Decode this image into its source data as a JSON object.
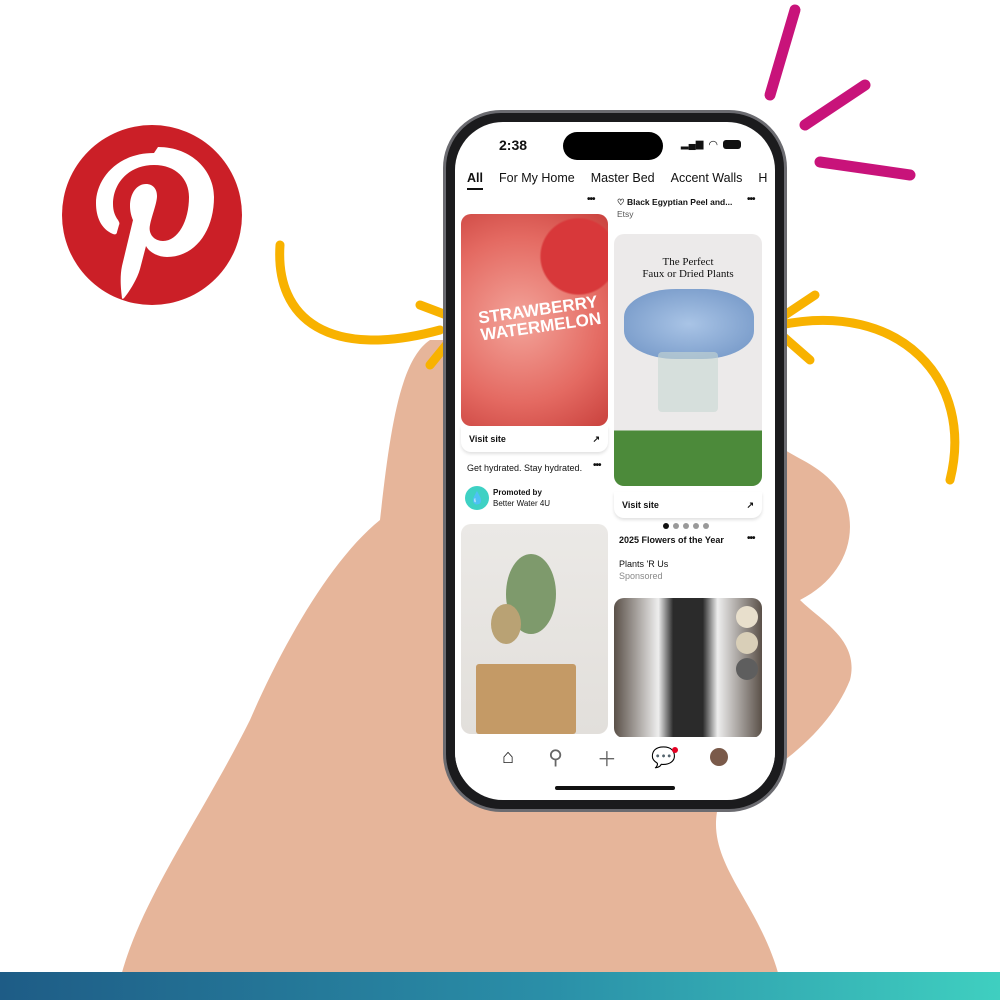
{
  "brand": {
    "logo": "pinterest-logo",
    "color": "#cb1f27"
  },
  "status_bar": {
    "time": "2:38"
  },
  "tabs": [
    {
      "label": "All",
      "active": true
    },
    {
      "label": "For My Home"
    },
    {
      "label": "Master Bed"
    },
    {
      "label": "Accent Walls"
    },
    {
      "label": "H"
    }
  ],
  "feed": {
    "top_right": {
      "title": "♡ Black Egyptian Peel and...",
      "source": "Etsy"
    },
    "pin1": {
      "image_text": "STRAWBERRY WATERMELON",
      "visit": "Visit site",
      "description": "Get hydrated. Stay hydrated.",
      "promoted_by": "Promoted by",
      "advertiser": "Better Water 4U"
    },
    "pin2": {
      "image_text_1": "The Perfect",
      "image_text_2": "Faux or Dried Plants",
      "visit": "Visit site",
      "carousel_total": 5,
      "carousel_index": 1,
      "title": "2025 Flowers of the Year",
      "advertiser": "Plants 'R Us",
      "sponsored": "Sponsored"
    }
  },
  "nav": {
    "items": [
      "home-icon",
      "search-icon",
      "plus-icon",
      "chat-icon",
      "profile-avatar"
    ]
  },
  "colors": {
    "arrow": "#f8b200",
    "accent": "#c8137a",
    "bottom_bar_start": "#1e5c86",
    "bottom_bar_end": "#3fcfc0"
  }
}
